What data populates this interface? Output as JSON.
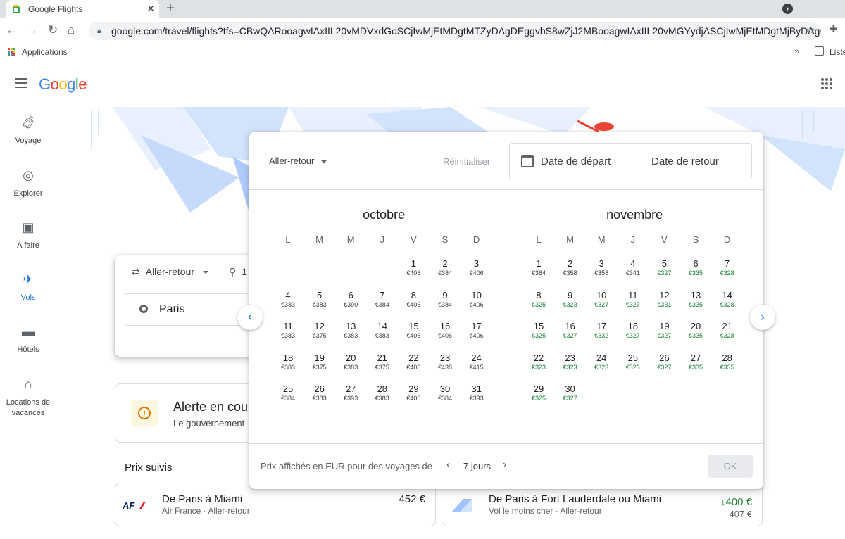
{
  "browser": {
    "tab_title": "Google Flights",
    "new_tab": "+",
    "close_tab": "✕",
    "url": "google.com/travel/flights?tfs=CBwQARooagwIAxIIL20vMDVxdGoSCjIwMjEtMDgtMTZyDAgDEggvbS8wZjJ2MBooagwIAxIIL20vMGYydjASCjIwMjEtMDgtMjByDAgDEggvb…",
    "bookmark_apps": "Applications",
    "bookmark_more": "»",
    "reading_list": "Liste"
  },
  "header": {
    "logo": "Google"
  },
  "logo_colors": [
    "#4285f4",
    "#ea4335",
    "#fbbc05",
    "#4285f4",
    "#34a853",
    "#ea4335"
  ],
  "sidebar": {
    "items": [
      {
        "label": "Voyage",
        "icon": "luggage-icon"
      },
      {
        "label": "Explorer",
        "icon": "explore-icon"
      },
      {
        "label": "À faire",
        "icon": "camera-icon"
      },
      {
        "label": "Vols",
        "icon": "airplane-icon",
        "active": true
      },
      {
        "label": "Hôtels",
        "icon": "hotel-bed-icon"
      },
      {
        "label": "Locations de vacances",
        "icon": "house-icon"
      }
    ]
  },
  "search": {
    "trip_type": "Aller-retour",
    "passengers": "1",
    "origin": "Paris"
  },
  "alert": {
    "title": "Alerte en cou",
    "text": "Le gouvernement"
  },
  "tracked": {
    "title": "Prix suivis",
    "cards": [
      {
        "route": "De Paris à Miami",
        "sub": "Air France · Aller-retour",
        "price": "452 €",
        "logo": "AF"
      },
      {
        "route": "De Paris à Fort Lauderdale ou Miami",
        "sub": "Vol le moins cher · Aller-retour",
        "price": "↓400 €",
        "old_price": "407 €"
      }
    ]
  },
  "dialog": {
    "trip_type": "Aller-retour",
    "reset": "Réinitialiser",
    "departure_placeholder": "Date de départ",
    "return_placeholder": "Date de retour",
    "footnote": "Prix affichés en EUR pour des voyages de",
    "duration": "7 jours",
    "ok": "OK",
    "weekdays": [
      "L",
      "M",
      "M",
      "J",
      "V",
      "S",
      "D"
    ],
    "months": [
      {
        "name": "octobre",
        "first_weekday": 4,
        "days": [
          {
            "d": "1",
            "p": "€406"
          },
          {
            "d": "2",
            "p": "€384"
          },
          {
            "d": "3",
            "p": "€406"
          },
          {
            "d": "4",
            "p": "€383"
          },
          {
            "d": "5",
            "p": "€383"
          },
          {
            "d": "6",
            "p": "€390"
          },
          {
            "d": "7",
            "p": "€384"
          },
          {
            "d": "8",
            "p": "€406"
          },
          {
            "d": "9",
            "p": "€384"
          },
          {
            "d": "10",
            "p": "€406"
          },
          {
            "d": "11",
            "p": "€383"
          },
          {
            "d": "12",
            "p": "€375"
          },
          {
            "d": "13",
            "p": "€383"
          },
          {
            "d": "14",
            "p": "€383"
          },
          {
            "d": "15",
            "p": "€406"
          },
          {
            "d": "16",
            "p": "€406"
          },
          {
            "d": "17",
            "p": "€406"
          },
          {
            "d": "18",
            "p": "€383"
          },
          {
            "d": "19",
            "p": "€375"
          },
          {
            "d": "20",
            "p": "€383"
          },
          {
            "d": "21",
            "p": "€375"
          },
          {
            "d": "22",
            "p": "€408"
          },
          {
            "d": "23",
            "p": "€438"
          },
          {
            "d": "24",
            "p": "€415"
          },
          {
            "d": "25",
            "p": "€384"
          },
          {
            "d": "26",
            "p": "€383"
          },
          {
            "d": "27",
            "p": "€393"
          },
          {
            "d": "28",
            "p": "€383"
          },
          {
            "d": "29",
            "p": "€400"
          },
          {
            "d": "30",
            "p": "€384"
          },
          {
            "d": "31",
            "p": "€393"
          }
        ]
      },
      {
        "name": "novembre",
        "first_weekday": 0,
        "days": [
          {
            "d": "1",
            "p": "€384"
          },
          {
            "d": "2",
            "p": "€358"
          },
          {
            "d": "3",
            "p": "€358"
          },
          {
            "d": "4",
            "p": "€341"
          },
          {
            "d": "5",
            "p": "€327",
            "low": true
          },
          {
            "d": "6",
            "p": "€335",
            "low": true
          },
          {
            "d": "7",
            "p": "€328",
            "low": true
          },
          {
            "d": "8",
            "p": "€325",
            "low": true
          },
          {
            "d": "9",
            "p": "€323",
            "low": true
          },
          {
            "d": "10",
            "p": "€327",
            "low": true
          },
          {
            "d": "11",
            "p": "€327",
            "low": true
          },
          {
            "d": "12",
            "p": "€331",
            "low": true
          },
          {
            "d": "13",
            "p": "€335",
            "low": true
          },
          {
            "d": "14",
            "p": "€328",
            "low": true
          },
          {
            "d": "15",
            "p": "€325",
            "low": true
          },
          {
            "d": "16",
            "p": "€327",
            "low": true
          },
          {
            "d": "17",
            "p": "€332",
            "low": true
          },
          {
            "d": "18",
            "p": "€327",
            "low": true
          },
          {
            "d": "19",
            "p": "€327",
            "low": true
          },
          {
            "d": "20",
            "p": "€335",
            "low": true
          },
          {
            "d": "21",
            "p": "€328",
            "low": true
          },
          {
            "d": "22",
            "p": "€323",
            "low": true
          },
          {
            "d": "23",
            "p": "€323",
            "low": true
          },
          {
            "d": "24",
            "p": "€323",
            "low": true
          },
          {
            "d": "25",
            "p": "€323",
            "low": true
          },
          {
            "d": "26",
            "p": "€327",
            "low": true
          },
          {
            "d": "27",
            "p": "€335",
            "low": true
          },
          {
            "d": "28",
            "p": "€335",
            "low": true
          },
          {
            "d": "29",
            "p": "€325",
            "low": true
          },
          {
            "d": "30",
            "p": "€327",
            "low": true
          }
        ]
      }
    ]
  },
  "colors": {
    "accent": "#1a73e8",
    "low_price": "#188038",
    "price_drop": "#188038"
  }
}
